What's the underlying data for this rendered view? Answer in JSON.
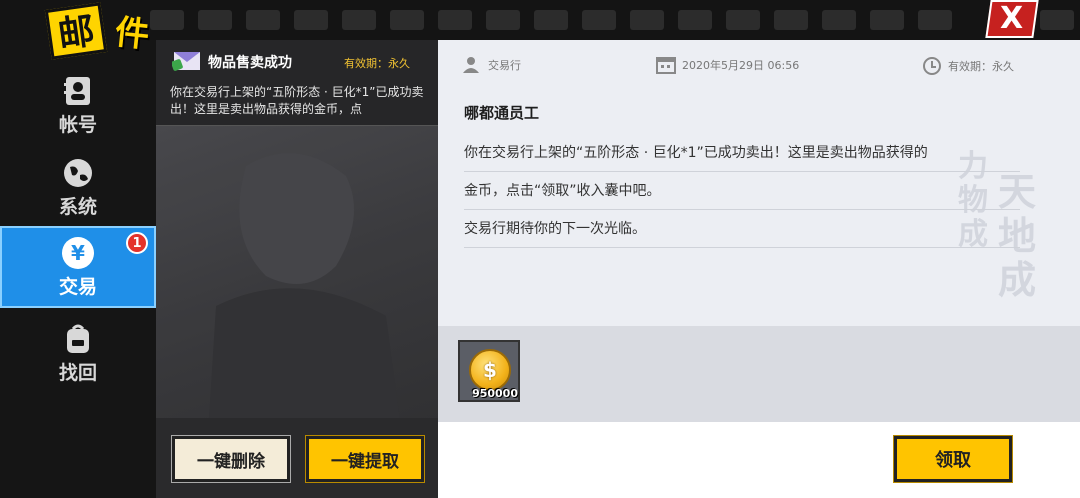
{
  "logo": {
    "char1": "邮",
    "char2": "件"
  },
  "close": {
    "label": "X"
  },
  "sidebar": {
    "items": [
      {
        "label": "帐号",
        "icon": "account-icon",
        "active": false
      },
      {
        "label": "系统",
        "icon": "globe-icon",
        "active": false
      },
      {
        "label": "交易",
        "icon": "yen-icon",
        "active": true,
        "badge": "1"
      },
      {
        "label": "找回",
        "icon": "backpack-icon",
        "active": false
      }
    ]
  },
  "mail_list": {
    "items": [
      {
        "title": "物品售卖成功",
        "expire": "有效期：永久",
        "preview": "你在交易行上架的“五阶形态 · 巨化*1”已成功卖出！这里是卖出物品获得的金币，点"
      }
    ],
    "delete_all_label": "一键删除",
    "claim_all_label": "一键提取"
  },
  "detail": {
    "from": "交易行",
    "datetime": "2020年5月29日  06:56",
    "expire": "有效期：永久",
    "sender": "哪都通员工",
    "lines": [
      "你在交易行上架的“五阶形态 · 巨化*1”已成功卖出！这里是卖出物品获得的",
      "金币，点击“领取”收入囊中吧。",
      "交易行期待你的下一次光临。"
    ],
    "attachment": {
      "icon": "gold-coin-icon",
      "quantity": "950000"
    },
    "claim_label": "领取"
  },
  "colors": {
    "accent_blue": "#1f8fe8",
    "button_yellow": "#ffc400",
    "badge_red": "#e4322b",
    "expire_gold": "#f1c232"
  }
}
